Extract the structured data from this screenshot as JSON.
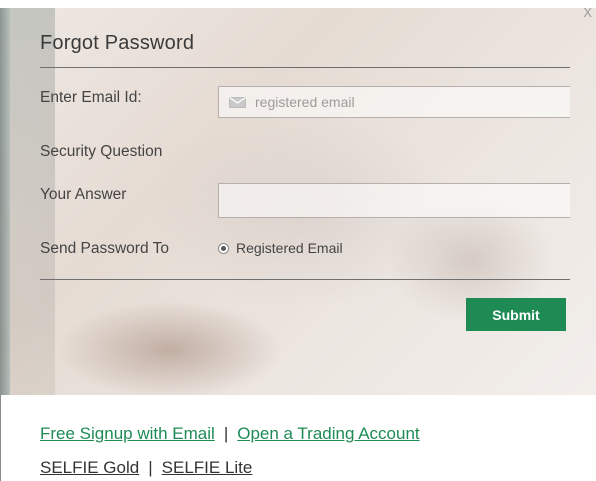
{
  "modal": {
    "title": "Forgot Password",
    "close_label": "X"
  },
  "form": {
    "email_label": "Enter Email Id:",
    "email_placeholder": "registered email",
    "email_value": "",
    "security_question_label": "Security Question",
    "answer_label": "Your Answer",
    "answer_value": "",
    "send_to_label": "Send Password To",
    "send_to_option": "Registered Email",
    "send_to_selected": true,
    "submit_label": "Submit"
  },
  "footer": {
    "signup_link": "Free Signup with Email",
    "separator": "|",
    "trading_link": "Open a Trading Account",
    "selfie_gold": "SELFIE Gold",
    "selfie_lite": "SELFIE Lite"
  },
  "colors": {
    "accent_green": "#1e8b55",
    "text_dark": "#333333"
  },
  "icons": {
    "email_field_icon": "mail-icon",
    "close_icon": "close-icon"
  }
}
